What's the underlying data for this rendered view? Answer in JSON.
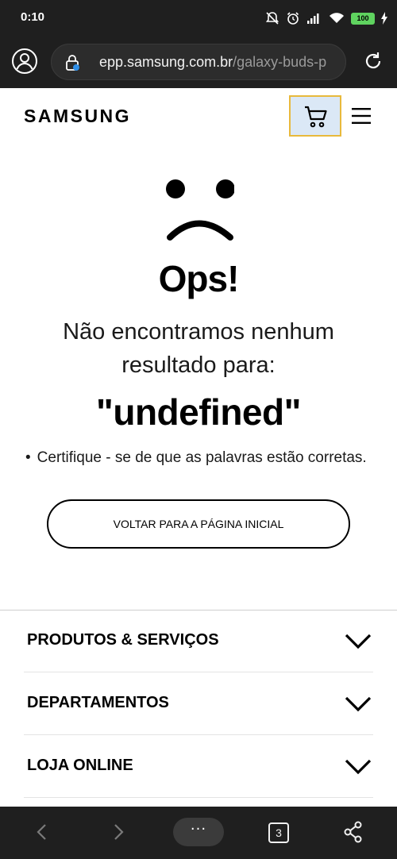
{
  "status_bar": {
    "time": "0:10",
    "battery": "100"
  },
  "browser": {
    "url_host": "epp.samsung.com.br",
    "url_path": "/galaxy-buds-p",
    "tab_count": "3",
    "more_label": "···"
  },
  "site": {
    "logo": "SAMSUNG"
  },
  "error": {
    "title": "Ops!",
    "message": "Não encontramos nenhum resultado para:",
    "term": "\"undefined\"",
    "tips": [
      "Certifique - se de que as palavras estão corretas."
    ],
    "home_button": "VOLTAR PARA A PÁGINA INICIAL"
  },
  "footer": {
    "sections": [
      {
        "label": "PRODUTOS & SERVIÇOS"
      },
      {
        "label": "DEPARTAMENTOS"
      },
      {
        "label": "LOJA ONLINE"
      }
    ]
  },
  "colors": {
    "chrome": "#1f1f1f",
    "cart_highlight_bg": "#dbe8f6",
    "cart_highlight_border": "#e8b93c",
    "battery": "#5fd35f"
  },
  "icons": {
    "status": [
      "silent-icon",
      "alarm-icon",
      "signal-icon",
      "wifi-icon",
      "battery-icon",
      "charging-icon"
    ],
    "toolbar": [
      "account-icon",
      "lock-icon",
      "reload-icon"
    ],
    "header": [
      "cart-icon",
      "menu-icon"
    ],
    "bottom_nav": [
      "back-icon",
      "forward-icon",
      "more-icon",
      "tabs-icon",
      "share-icon"
    ]
  }
}
